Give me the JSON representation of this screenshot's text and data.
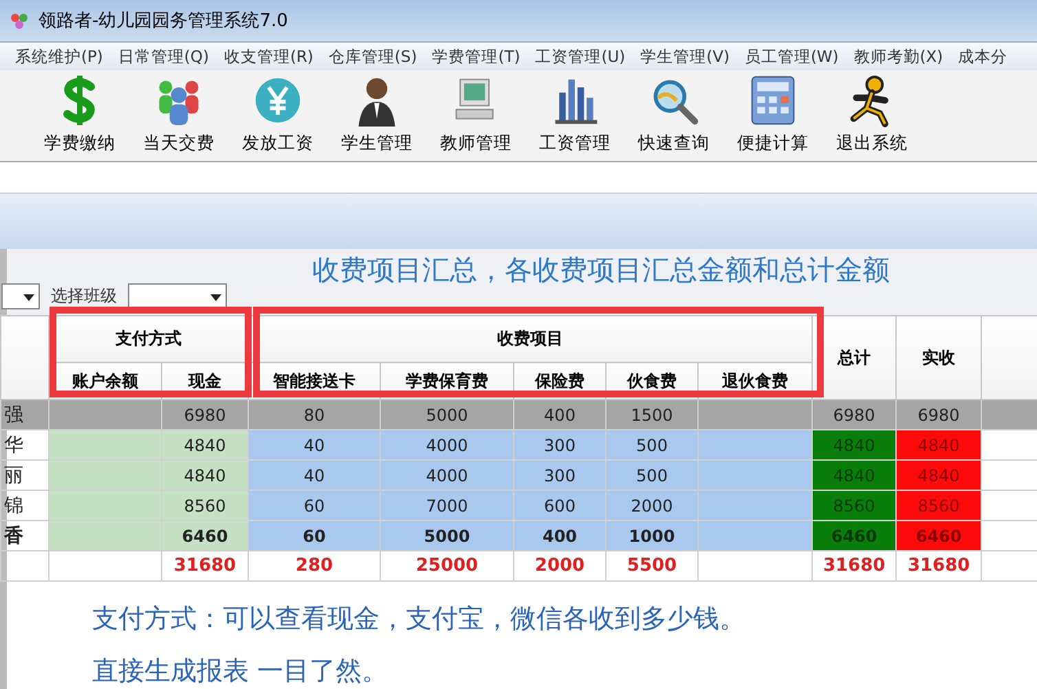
{
  "window": {
    "title": "领路者-幼儿园园务管理系统7.0"
  },
  "menu": [
    "系统维护(P)",
    "日常管理(Q)",
    "收支管理(R)",
    "仓库管理(S)",
    "学费管理(T)",
    "工资管理(U)",
    "学生管理(V)",
    "员工管理(W)",
    "教师考勤(X)",
    "成本分"
  ],
  "toolbar": [
    {
      "label": "学费缴纳",
      "kind": "dollar"
    },
    {
      "label": "当天交费",
      "kind": "people"
    },
    {
      "label": "发放工资",
      "kind": "yen"
    },
    {
      "label": "学生管理",
      "kind": "person"
    },
    {
      "label": "教师管理",
      "kind": "computer"
    },
    {
      "label": "工资管理",
      "kind": "chart"
    },
    {
      "label": "快速查询",
      "kind": "magnifier"
    },
    {
      "label": "便捷计算",
      "kind": "calculator"
    },
    {
      "label": "退出系统",
      "kind": "runner"
    }
  ],
  "filter": {
    "label": "选择班级"
  },
  "heading": "收费项目汇总，各收费项目汇总金额和总计金额",
  "table": {
    "group_headers": [
      "支付方式",
      "收费项目"
    ],
    "columns": [
      "账户余额",
      "现金",
      "智能接送卡",
      "学费保育费",
      "保险费",
      "伙食费",
      "退伙食费",
      "总计",
      "实收"
    ],
    "rows": [
      {
        "name": "强",
        "selected": true,
        "bold": false,
        "cells": [
          null,
          "6980",
          "80",
          "5000",
          "400",
          "1500",
          null,
          "6980",
          "6980"
        ]
      },
      {
        "name": "华",
        "selected": false,
        "bold": false,
        "cells": [
          null,
          "4840",
          "40",
          "4000",
          "300",
          "500",
          null,
          "4840",
          "4840"
        ]
      },
      {
        "name": "丽",
        "selected": false,
        "bold": false,
        "cells": [
          null,
          "4840",
          "40",
          "4000",
          "300",
          "500",
          null,
          "4840",
          "4840"
        ]
      },
      {
        "name": "锦",
        "selected": false,
        "bold": false,
        "cells": [
          null,
          "8560",
          "60",
          "7000",
          "600",
          "2000",
          null,
          "8560",
          "8560"
        ]
      },
      {
        "name": "香",
        "selected": false,
        "bold": true,
        "cells": [
          null,
          "6460",
          "60",
          "5000",
          "400",
          "1000",
          null,
          "6460",
          "6460"
        ]
      }
    ],
    "totals": {
      "cash": "31680",
      "shuttle_card": "280",
      "tuition": "25000",
      "insurance": "2000",
      "meals": "5500",
      "total": "31680",
      "received": "31680"
    }
  },
  "notes": [
    "支付方式：可以查看现金，支付宝，微信各收到多少钱。",
    "直接生成报表  一目了然。"
  ]
}
